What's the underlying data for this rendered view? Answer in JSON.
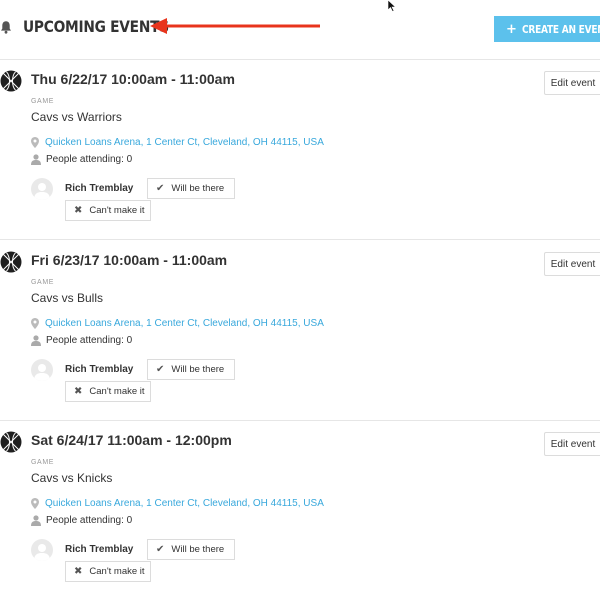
{
  "header": {
    "title": "UPCOMING EVENTS",
    "create_label": "CREATE AN EVENT",
    "create_plus": "+",
    "accent_color": "#5cc1ec",
    "annotation_arrow_color": "#e8341c"
  },
  "events": [
    {
      "date": "Thu 6/22/17 10:00am - 11:00am",
      "type": "GAME",
      "name": "Cavs vs Warriors",
      "location": "Quicken Loans Arena, 1 Center Ct, Cleveland, OH 44115, USA",
      "attending": "People attending: 0",
      "person": "Rich Tremblay",
      "yes_label": "Will be there",
      "no_label": "Can't make it",
      "edit_label": "Edit event"
    },
    {
      "date": "Fri 6/23/17 10:00am - 11:00am",
      "type": "GAME",
      "name": "Cavs vs Bulls",
      "location": "Quicken Loans Arena, 1 Center Ct, Cleveland, OH 44115, USA",
      "attending": "People attending: 0",
      "person": "Rich Tremblay",
      "yes_label": "Will be there",
      "no_label": "Can't make it",
      "edit_label": "Edit event"
    },
    {
      "date": "Sat 6/24/17 11:00am - 12:00pm",
      "type": "GAME",
      "name": "Cavs vs Knicks",
      "location": "Quicken Loans Arena, 1 Center Ct, Cleveland, OH 44115, USA",
      "attending": "People attending: 0",
      "person": "Rich Tremblay",
      "yes_label": "Will be there",
      "no_label": "Can't make it",
      "edit_label": "Edit event"
    }
  ],
  "icons": {
    "header": "bell-icon",
    "event": "basketball-icon",
    "location": "map-pin-icon",
    "attending": "person-icon",
    "yes": "check-icon",
    "no": "x-icon"
  }
}
